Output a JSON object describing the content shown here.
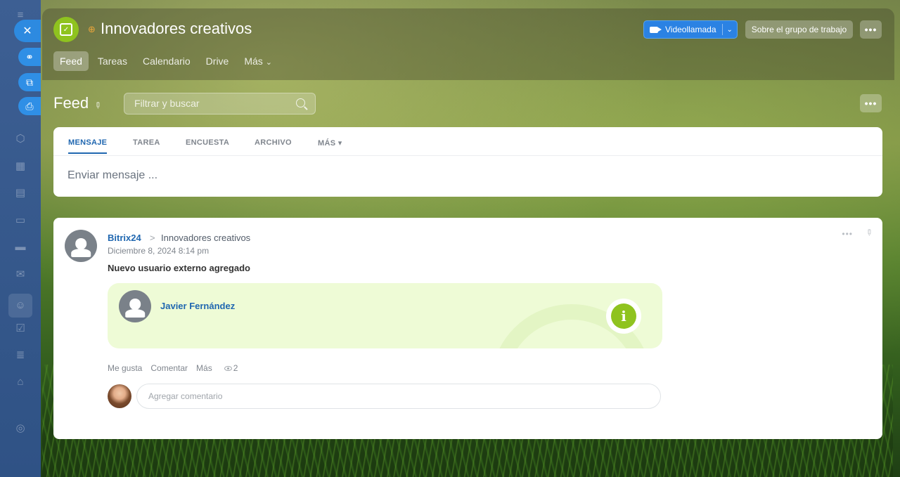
{
  "group": {
    "title": "Innovadores creativos",
    "video_label": "Videollamada",
    "about_label": "Sobre el grupo de trabajo",
    "more_label": "•••"
  },
  "nav": {
    "items": [
      {
        "label": "Feed"
      },
      {
        "label": "Tareas"
      },
      {
        "label": "Calendario"
      },
      {
        "label": "Drive"
      },
      {
        "label": "Más"
      }
    ],
    "more_chevron": "⌄"
  },
  "feed": {
    "title": "Feed",
    "search_placeholder": "Filtrar y buscar",
    "more_label": "•••"
  },
  "composer": {
    "tabs": [
      {
        "label": "MENSAJE"
      },
      {
        "label": "TAREA"
      },
      {
        "label": "ENCUESTA"
      },
      {
        "label": "ARCHIVO"
      },
      {
        "label": "MÁS ▾"
      }
    ],
    "placeholder": "Enviar mensaje ..."
  },
  "post": {
    "author": "Bitrix24",
    "arrow": ">",
    "destination": "Innovadores creativos",
    "date": "Diciembre 8, 2024 8:14 pm",
    "text": "Nuevo usuario externo agregado",
    "card_name": "Javier Fernández",
    "actions": {
      "like": "Me gusta",
      "comment": "Comentar",
      "more": "Más",
      "views": "2"
    },
    "comment_placeholder": "Agregar comentario",
    "menu_dots": "•••"
  },
  "colors": {
    "accent": "#2067b0",
    "green": "#8fc31f",
    "video_button": "#2b82e3"
  }
}
